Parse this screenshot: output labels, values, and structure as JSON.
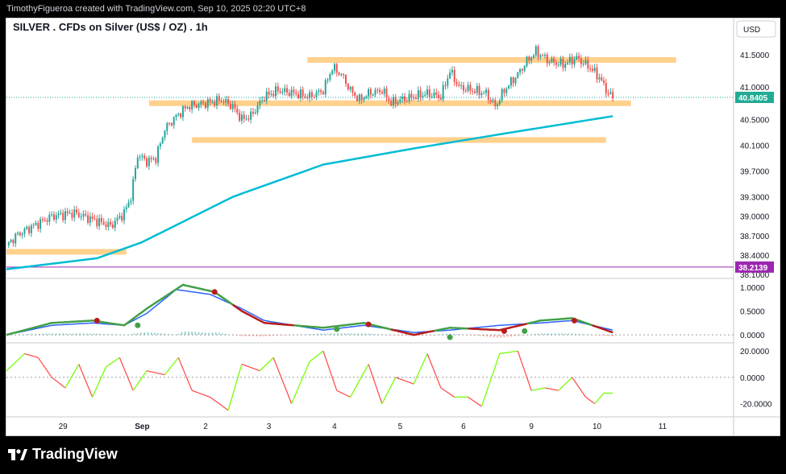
{
  "header": {
    "attribution": "TimothyFigueroa created with TradingView.com, Sep 10, 2025 02:20 UTC+8"
  },
  "chart": {
    "title": "SILVER . CFDs on Silver (US$ / OZ) . 1h",
    "currency_button": "USD",
    "price_ticks": [
      "41.5000",
      "41.0000",
      "40.5000",
      "40.1000",
      "39.7000",
      "39.3000",
      "39.0000",
      "38.7000",
      "38.4000",
      "38.1000"
    ],
    "osc1_ticks": [
      "1.0000",
      "0.5000",
      "0.0000"
    ],
    "osc2_ticks": [
      "20.0000",
      "0.0000",
      "-20.0000"
    ],
    "time_labels": [
      "29",
      "Sep",
      "2",
      "3",
      "4",
      "5",
      "6",
      "9",
      "10",
      "11"
    ],
    "last_price_label": "40.8405",
    "level_label": "38.2139"
  },
  "footer": {
    "logo_text": "TradingView"
  },
  "colors": {
    "up": "#26a69a",
    "down": "#ef5350",
    "ma": "#00bcd4",
    "zone": "#ffcc80",
    "level": "#9c27b0",
    "last_price": "#22ab94",
    "macd_fast": "#2962ff",
    "green_line": "#43a047",
    "red_line": "#b71c1c",
    "osc_green": "#76ff03",
    "osc_red": "#ff5252"
  },
  "chart_data": [
    {
      "type": "candlestick",
      "title": "SILVER . CFDs on Silver (US$ / OZ) . 1h",
      "x_labels": [
        "29",
        "Sep",
        "2",
        "3",
        "4",
        "5",
        "6",
        "9",
        "10",
        "11"
      ],
      "ylim": [
        38.05,
        41.75
      ],
      "last_price": 40.8405,
      "horizontal_level": 38.2139,
      "close_path": [
        [
          0,
          38.55
        ],
        [
          5,
          38.72
        ],
        [
          12,
          38.85
        ],
        [
          20,
          39.0
        ],
        [
          30,
          39.05
        ],
        [
          38,
          38.95
        ],
        [
          46,
          38.85
        ],
        [
          52,
          39.05
        ],
        [
          55,
          39.3
        ],
        [
          58,
          39.95
        ],
        [
          62,
          39.85
        ],
        [
          66,
          39.9
        ],
        [
          70,
          40.35
        ],
        [
          75,
          40.55
        ],
        [
          80,
          40.7
        ],
        [
          88,
          40.75
        ],
        [
          95,
          40.8
        ],
        [
          100,
          40.7
        ],
        [
          104,
          40.5
        ],
        [
          108,
          40.55
        ],
        [
          114,
          40.85
        ],
        [
          120,
          40.95
        ],
        [
          128,
          40.9
        ],
        [
          134,
          40.85
        ],
        [
          140,
          40.95
        ],
        [
          144,
          41.3
        ],
        [
          148,
          41.2
        ],
        [
          152,
          40.95
        ],
        [
          156,
          40.8
        ],
        [
          160,
          40.9
        ],
        [
          166,
          40.95
        ],
        [
          170,
          40.75
        ],
        [
          174,
          40.8
        ],
        [
          180,
          40.85
        ],
        [
          186,
          40.9
        ],
        [
          192,
          40.85
        ],
        [
          196,
          41.25
        ],
        [
          200,
          41.0
        ],
        [
          206,
          40.95
        ],
        [
          212,
          40.9
        ],
        [
          216,
          40.7
        ],
        [
          220,
          40.95
        ],
        [
          226,
          41.2
        ],
        [
          230,
          41.4
        ],
        [
          234,
          41.55
        ],
        [
          240,
          41.4
        ],
        [
          246,
          41.35
        ],
        [
          252,
          41.45
        ],
        [
          258,
          41.3
        ],
        [
          262,
          41.15
        ],
        [
          266,
          40.9
        ],
        [
          268,
          40.84
        ]
      ],
      "moving_average": [
        [
          0,
          38.18
        ],
        [
          40,
          38.35
        ],
        [
          60,
          38.6
        ],
        [
          100,
          39.3
        ],
        [
          140,
          39.8
        ],
        [
          180,
          40.05
        ],
        [
          220,
          40.28
        ],
        [
          268,
          40.55
        ]
      ],
      "zones": [
        {
          "x": [
            133,
            296
          ],
          "y": 41.42
        },
        {
          "x": [
            63,
            276
          ],
          "y": 40.75
        },
        {
          "x": [
            82,
            265
          ],
          "y": 40.18
        },
        {
          "x": [
            0,
            53
          ],
          "y": 38.45
        }
      ]
    },
    {
      "type": "line",
      "name_hint": "oscillator-1",
      "ylim": [
        -0.15,
        1.15
      ],
      "series": [
        {
          "name": "",
          "values": [
            [
              0,
              0.0
            ],
            [
              20,
              0.2
            ],
            [
              38,
              0.25
            ],
            [
              52,
              0.2
            ],
            [
              62,
              0.45
            ],
            [
              75,
              0.95
            ],
            [
              90,
              0.85
            ],
            [
              104,
              0.55
            ],
            [
              114,
              0.3
            ],
            [
              140,
              0.1
            ],
            [
              158,
              0.2
            ],
            [
              180,
              0.05
            ],
            [
              196,
              0.1
            ],
            [
              218,
              0.2
            ],
            [
              236,
              0.25
            ],
            [
              250,
              0.3
            ],
            [
              268,
              0.1
            ]
          ]
        },
        {
          "name": "",
          "values": [
            [
              0,
              0.0
            ],
            [
              20,
              0.25
            ],
            [
              38,
              0.3
            ],
            [
              52,
              0.2
            ],
            [
              62,
              0.55
            ],
            [
              78,
              1.05
            ],
            [
              92,
              0.9
            ],
            [
              104,
              0.5
            ],
            [
              114,
              0.25
            ],
            [
              140,
              0.15
            ],
            [
              158,
              0.25
            ],
            [
              180,
              0.0
            ],
            [
              196,
              0.15
            ],
            [
              218,
              0.1
            ],
            [
              236,
              0.3
            ],
            [
              250,
              0.35
            ],
            [
              268,
              0.05
            ]
          ]
        }
      ],
      "markers": [
        {
          "x": 40,
          "value": 0.3,
          "color": "red"
        },
        {
          "x": 58,
          "value": 0.2,
          "color": "green"
        },
        {
          "x": 92,
          "value": 0.9,
          "color": "red"
        },
        {
          "x": 146,
          "value": 0.12,
          "color": "green"
        },
        {
          "x": 160,
          "value": 0.22,
          "color": "red"
        },
        {
          "x": 196,
          "value": -0.05,
          "color": "green"
        },
        {
          "x": 220,
          "value": 0.08,
          "color": "red"
        },
        {
          "x": 229,
          "value": 0.08,
          "color": "green"
        },
        {
          "x": 251,
          "value": 0.3,
          "color": "red"
        }
      ]
    },
    {
      "type": "line",
      "name_hint": "oscillator-2",
      "ylim": [
        -30,
        25
      ],
      "series": [
        {
          "name": "",
          "values": [
            [
              0,
              5
            ],
            [
              8,
              18
            ],
            [
              14,
              15
            ],
            [
              20,
              0
            ],
            [
              26,
              -8
            ],
            [
              32,
              10
            ],
            [
              38,
              -15
            ],
            [
              44,
              8
            ],
            [
              50,
              15
            ],
            [
              56,
              -10
            ],
            [
              62,
              5
            ],
            [
              70,
              2
            ],
            [
              76,
              15
            ],
            [
              82,
              -10
            ],
            [
              90,
              -15
            ],
            [
              98,
              -25
            ],
            [
              104,
              10
            ],
            [
              112,
              5
            ],
            [
              118,
              15
            ],
            [
              126,
              -20
            ],
            [
              134,
              12
            ],
            [
              140,
              20
            ],
            [
              146,
              -10
            ],
            [
              152,
              -15
            ],
            [
              160,
              10
            ],
            [
              166,
              -20
            ],
            [
              172,
              0
            ],
            [
              180,
              -5
            ],
            [
              186,
              18
            ],
            [
              192,
              -8
            ],
            [
              198,
              -15
            ],
            [
              204,
              -15
            ],
            [
              210,
              -22
            ],
            [
              218,
              18
            ],
            [
              226,
              20
            ],
            [
              232,
              -10
            ],
            [
              238,
              -8
            ],
            [
              244,
              -10
            ],
            [
              250,
              0
            ],
            [
              256,
              -15
            ],
            [
              260,
              -20
            ],
            [
              264,
              -12
            ],
            [
              268,
              -12
            ]
          ]
        }
      ]
    }
  ]
}
